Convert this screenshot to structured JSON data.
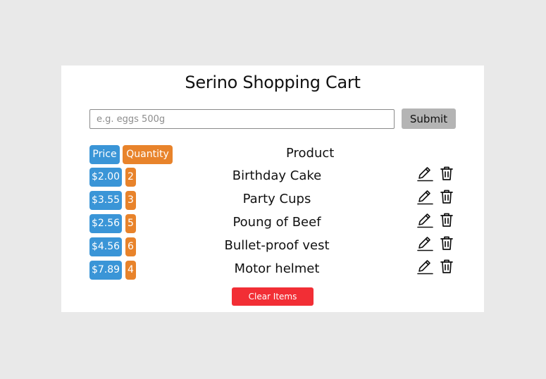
{
  "app": {
    "title": "Serino Shopping Cart"
  },
  "entry": {
    "placeholder": "e.g. eggs 500g",
    "value": "",
    "submit_label": "Submit"
  },
  "table": {
    "headers": {
      "price": "Price",
      "quantity": "Quantity",
      "product": "Product"
    },
    "rows": [
      {
        "price": "$2.00",
        "quantity": "2",
        "product": "Birthday Cake"
      },
      {
        "price": "$3.55",
        "quantity": "3",
        "product": "Party Cups"
      },
      {
        "price": "$2.56",
        "quantity": "5",
        "product": "Poung of Beef"
      },
      {
        "price": "$4.56",
        "quantity": "6",
        "product": "Bullet-proof vest"
      },
      {
        "price": "$7.89",
        "quantity": "4",
        "product": "Motor helmet"
      }
    ]
  },
  "actions": {
    "clear_label": "Clear Items"
  },
  "colors": {
    "background": "#e9e9e9",
    "price_badge": "#3a95d7",
    "quantity_badge": "#e8832b",
    "submit_button": "#b4b4b4",
    "clear_button": "#f22e35"
  },
  "icons": {
    "edit": "pencil-icon",
    "delete": "trash-icon"
  }
}
